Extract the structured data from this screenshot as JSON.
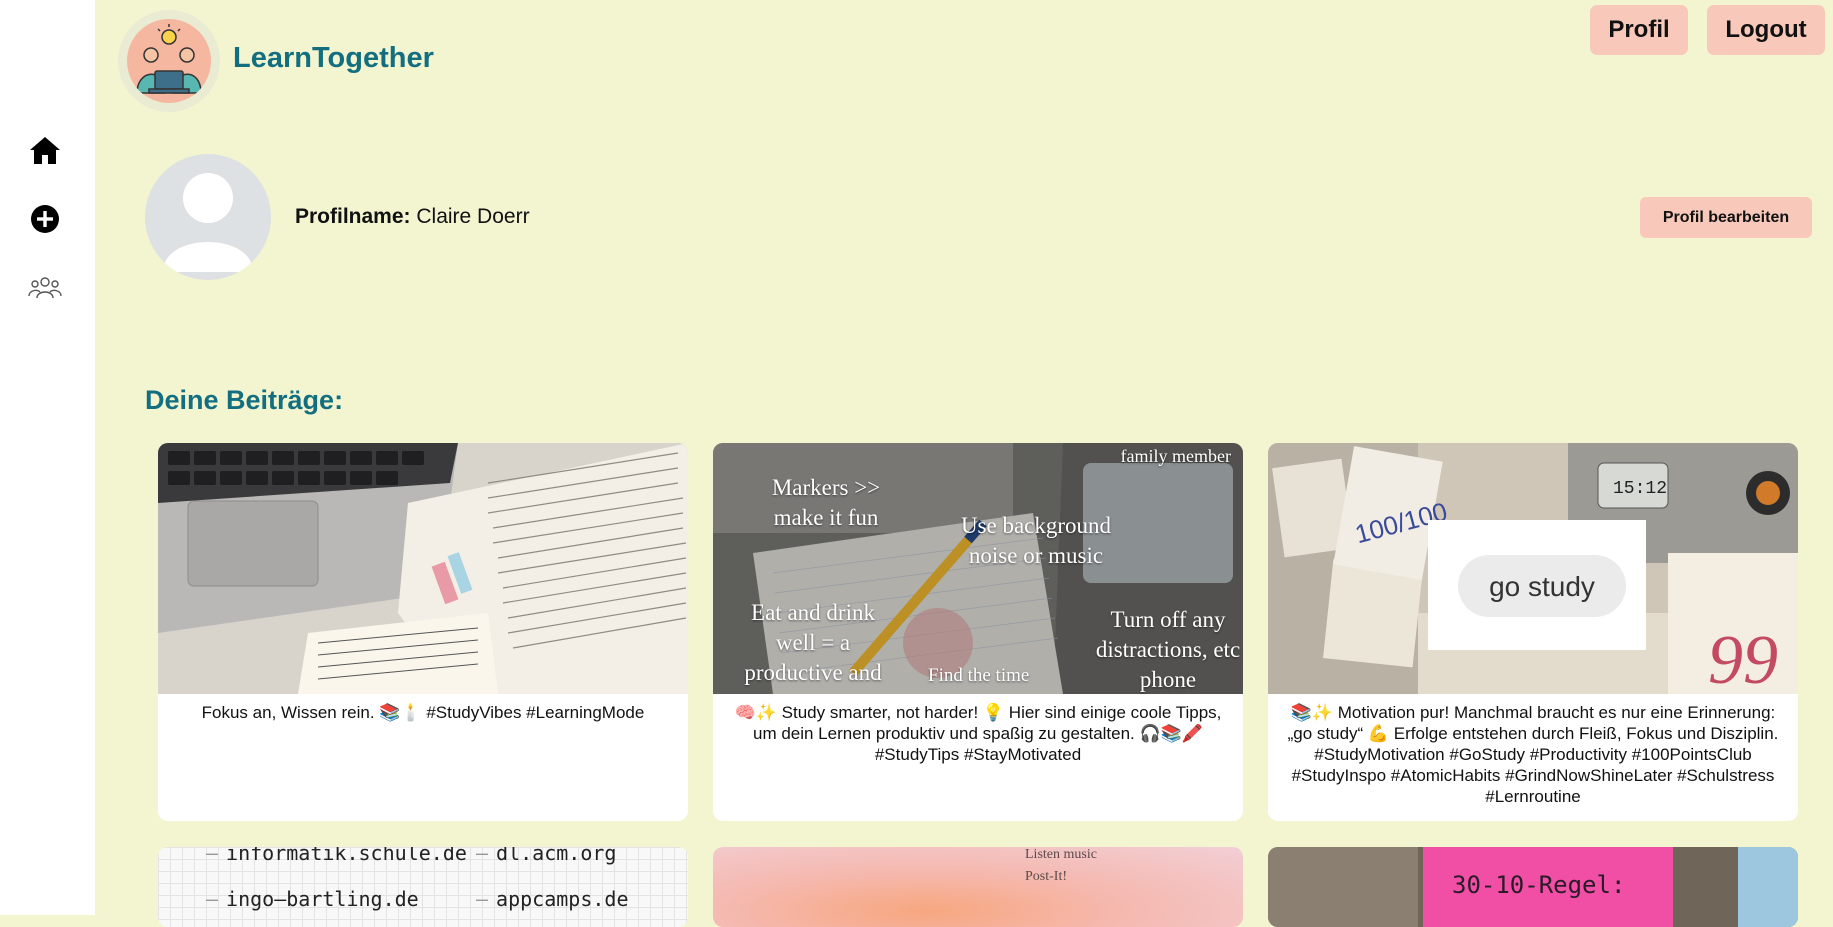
{
  "app": {
    "name": "LearnTogether"
  },
  "sidebar": {
    "items": [
      {
        "icon": "home-icon"
      },
      {
        "icon": "add-icon"
      },
      {
        "icon": "community-icon"
      }
    ]
  },
  "header": {
    "profile_label": "Profil",
    "logout_label": "Logout"
  },
  "profile": {
    "name_label": "Profilname:",
    "name_value": "Claire Doerr",
    "edit_label": "Profil bearbeiten"
  },
  "posts": {
    "title": "Deine Beiträge:",
    "items": [
      {
        "caption": "Fokus an, Wissen rein. 📚🕯️ #StudyVibes #LearningMode",
        "image_text": []
      },
      {
        "caption": "🧠✨ Study smarter, not harder! 💡 Hier sind einige coole Tipps, um dein Lernen produktiv und spaßig zu gestalten. 🎧📚🖍️ #StudyTips #StayMotivated",
        "image_text": [
          "family member",
          "Markers >> make it fun",
          "Use background noise or music",
          "Eat and drink well = a productive and",
          "Turn off any distractions, etc phone",
          "Find the time"
        ]
      },
      {
        "caption": "📚✨ Motivation pur! Manchmal braucht es nur eine Erinnerung: „go study“ 💪 Erfolge entstehen durch Fleiß, Fokus und Disziplin. #StudyMotivation #GoStudy #Productivity #100PointsClub #StudyInspo #AtomicHabits #GrindNowShineLater #Schulstress #Lernroutine",
        "image_text": [
          "go study",
          "100/100",
          "15:12",
          "99"
        ]
      },
      {
        "image_text": [
          "informatik.schule.de",
          "dl.acm.org",
          "ingo–bartling.de",
          "appcamps.de"
        ]
      },
      {
        "image_text": [
          "Listen music",
          "Post-It!"
        ]
      },
      {
        "image_text": [
          "30-10-Regel:"
        ]
      }
    ]
  },
  "colors": {
    "background": "#f2f5d0",
    "accent": "#136f80",
    "button": "#f8c9ba",
    "sidebar": "#ffffff"
  }
}
